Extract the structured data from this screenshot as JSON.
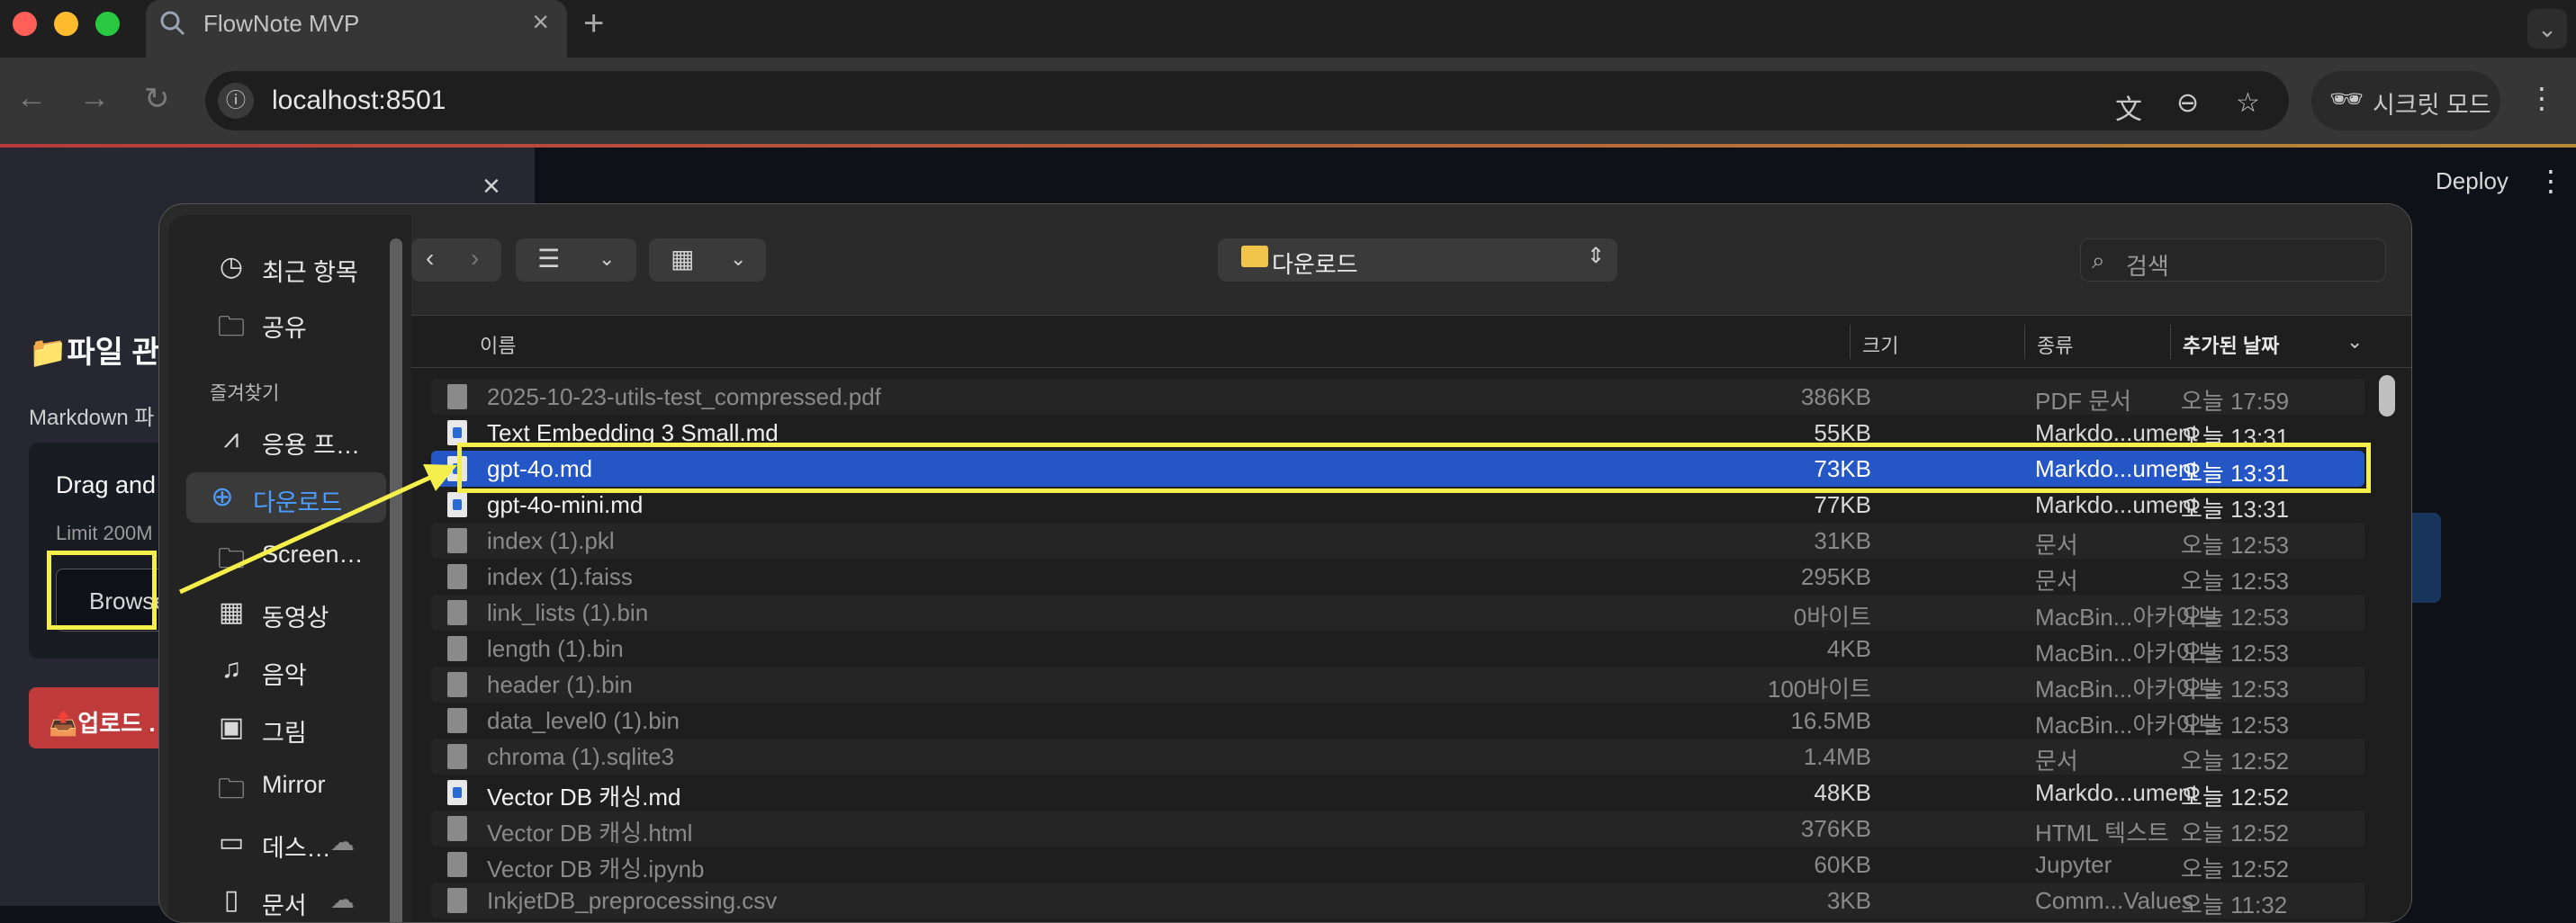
{
  "browser": {
    "tab_title": "FlowNote MVP",
    "url": "localhost:8501",
    "incognito_label": "시크릿 모드",
    "traffic_colors": [
      "#ff5f57",
      "#febc2e",
      "#28c840"
    ]
  },
  "app": {
    "sidebar_title": "📁파일 관",
    "sidebar_subtitle": "Markdown 파",
    "dropzone_text": "Drag and",
    "dropzone_limit": "Limit 200M",
    "browse_label": "Browse",
    "upload_label": "📤업로드 .",
    "deploy_label": "Deploy",
    "accent_color": "#ff4b4b"
  },
  "dialog": {
    "location": "다운로드",
    "search_placeholder": "검색",
    "sidebar": {
      "recent": "최근 항목",
      "shared": "공유",
      "favorites_header": "즐겨찾기",
      "items": [
        {
          "label": "응용 프…",
          "icon": "apps-icon"
        },
        {
          "label": "다운로드",
          "icon": "download-icon"
        },
        {
          "label": "Screen…",
          "icon": "folder-icon"
        },
        {
          "label": "동영상",
          "icon": "film-icon"
        },
        {
          "label": "음악",
          "icon": "music-icon"
        },
        {
          "label": "그림",
          "icon": "photo-icon"
        },
        {
          "label": "Mirror",
          "icon": "folder-icon"
        },
        {
          "label": "데스…",
          "icon": "desktop-icon"
        },
        {
          "label": "문서",
          "icon": "doc-icon"
        }
      ]
    },
    "columns": {
      "name": "이름",
      "size": "크기",
      "kind": "종류",
      "date_added": "추가된 날짜"
    },
    "files": [
      {
        "name": "2025-10-23-utils-test_compressed.pdf",
        "size": "386KB",
        "kind": "PDF 문서",
        "date": "오늘 17:59",
        "enabled": false,
        "type": "doc"
      },
      {
        "name": "Text Embedding 3 Small.md",
        "size": "55KB",
        "kind": "Markdo...ument",
        "date": "오늘 13:31",
        "enabled": true,
        "type": "md"
      },
      {
        "name": "gpt-4o.md",
        "size": "73KB",
        "kind": "Markdo...ument",
        "date": "오늘 13:31",
        "enabled": true,
        "type": "md",
        "selected": true
      },
      {
        "name": "gpt-4o-mini.md",
        "size": "77KB",
        "kind": "Markdo...ument",
        "date": "오늘 13:31",
        "enabled": true,
        "type": "md"
      },
      {
        "name": "index (1).pkl",
        "size": "31KB",
        "kind": "문서",
        "date": "오늘 12:53",
        "enabled": false,
        "type": "doc"
      },
      {
        "name": "index (1).faiss",
        "size": "295KB",
        "kind": "문서",
        "date": "오늘 12:53",
        "enabled": false,
        "type": "doc"
      },
      {
        "name": "link_lists (1).bin",
        "size": "0바이트",
        "kind": "MacBin...아카이브",
        "date": "오늘 12:53",
        "enabled": false,
        "type": "doc"
      },
      {
        "name": "length (1).bin",
        "size": "4KB",
        "kind": "MacBin...아카이브",
        "date": "오늘 12:53",
        "enabled": false,
        "type": "doc"
      },
      {
        "name": "header (1).bin",
        "size": "100바이트",
        "kind": "MacBin...아카이브",
        "date": "오늘 12:53",
        "enabled": false,
        "type": "doc"
      },
      {
        "name": "data_level0 (1).bin",
        "size": "16.5MB",
        "kind": "MacBin...아카이브",
        "date": "오늘 12:53",
        "enabled": false,
        "type": "doc"
      },
      {
        "name": "chroma (1).sqlite3",
        "size": "1.4MB",
        "kind": "문서",
        "date": "오늘 12:52",
        "enabled": false,
        "type": "doc"
      },
      {
        "name": "Vector DB 캐싱.md",
        "size": "48KB",
        "kind": "Markdo...ument",
        "date": "오늘 12:52",
        "enabled": true,
        "type": "md"
      },
      {
        "name": "Vector DB 캐싱.html",
        "size": "376KB",
        "kind": "HTML 텍스트",
        "date": "오늘 12:52",
        "enabled": false,
        "type": "doc"
      },
      {
        "name": "Vector DB 캐싱.ipynb",
        "size": "60KB",
        "kind": "Jupyter",
        "date": "오늘 12:52",
        "enabled": false,
        "type": "doc"
      },
      {
        "name": "InkjetDB_preprocessing.csv",
        "size": "3KB",
        "kind": "Comm...Values",
        "date": "오늘 11:32",
        "enabled": false,
        "type": "doc"
      }
    ]
  },
  "annotation_color": "#f4ef4a"
}
